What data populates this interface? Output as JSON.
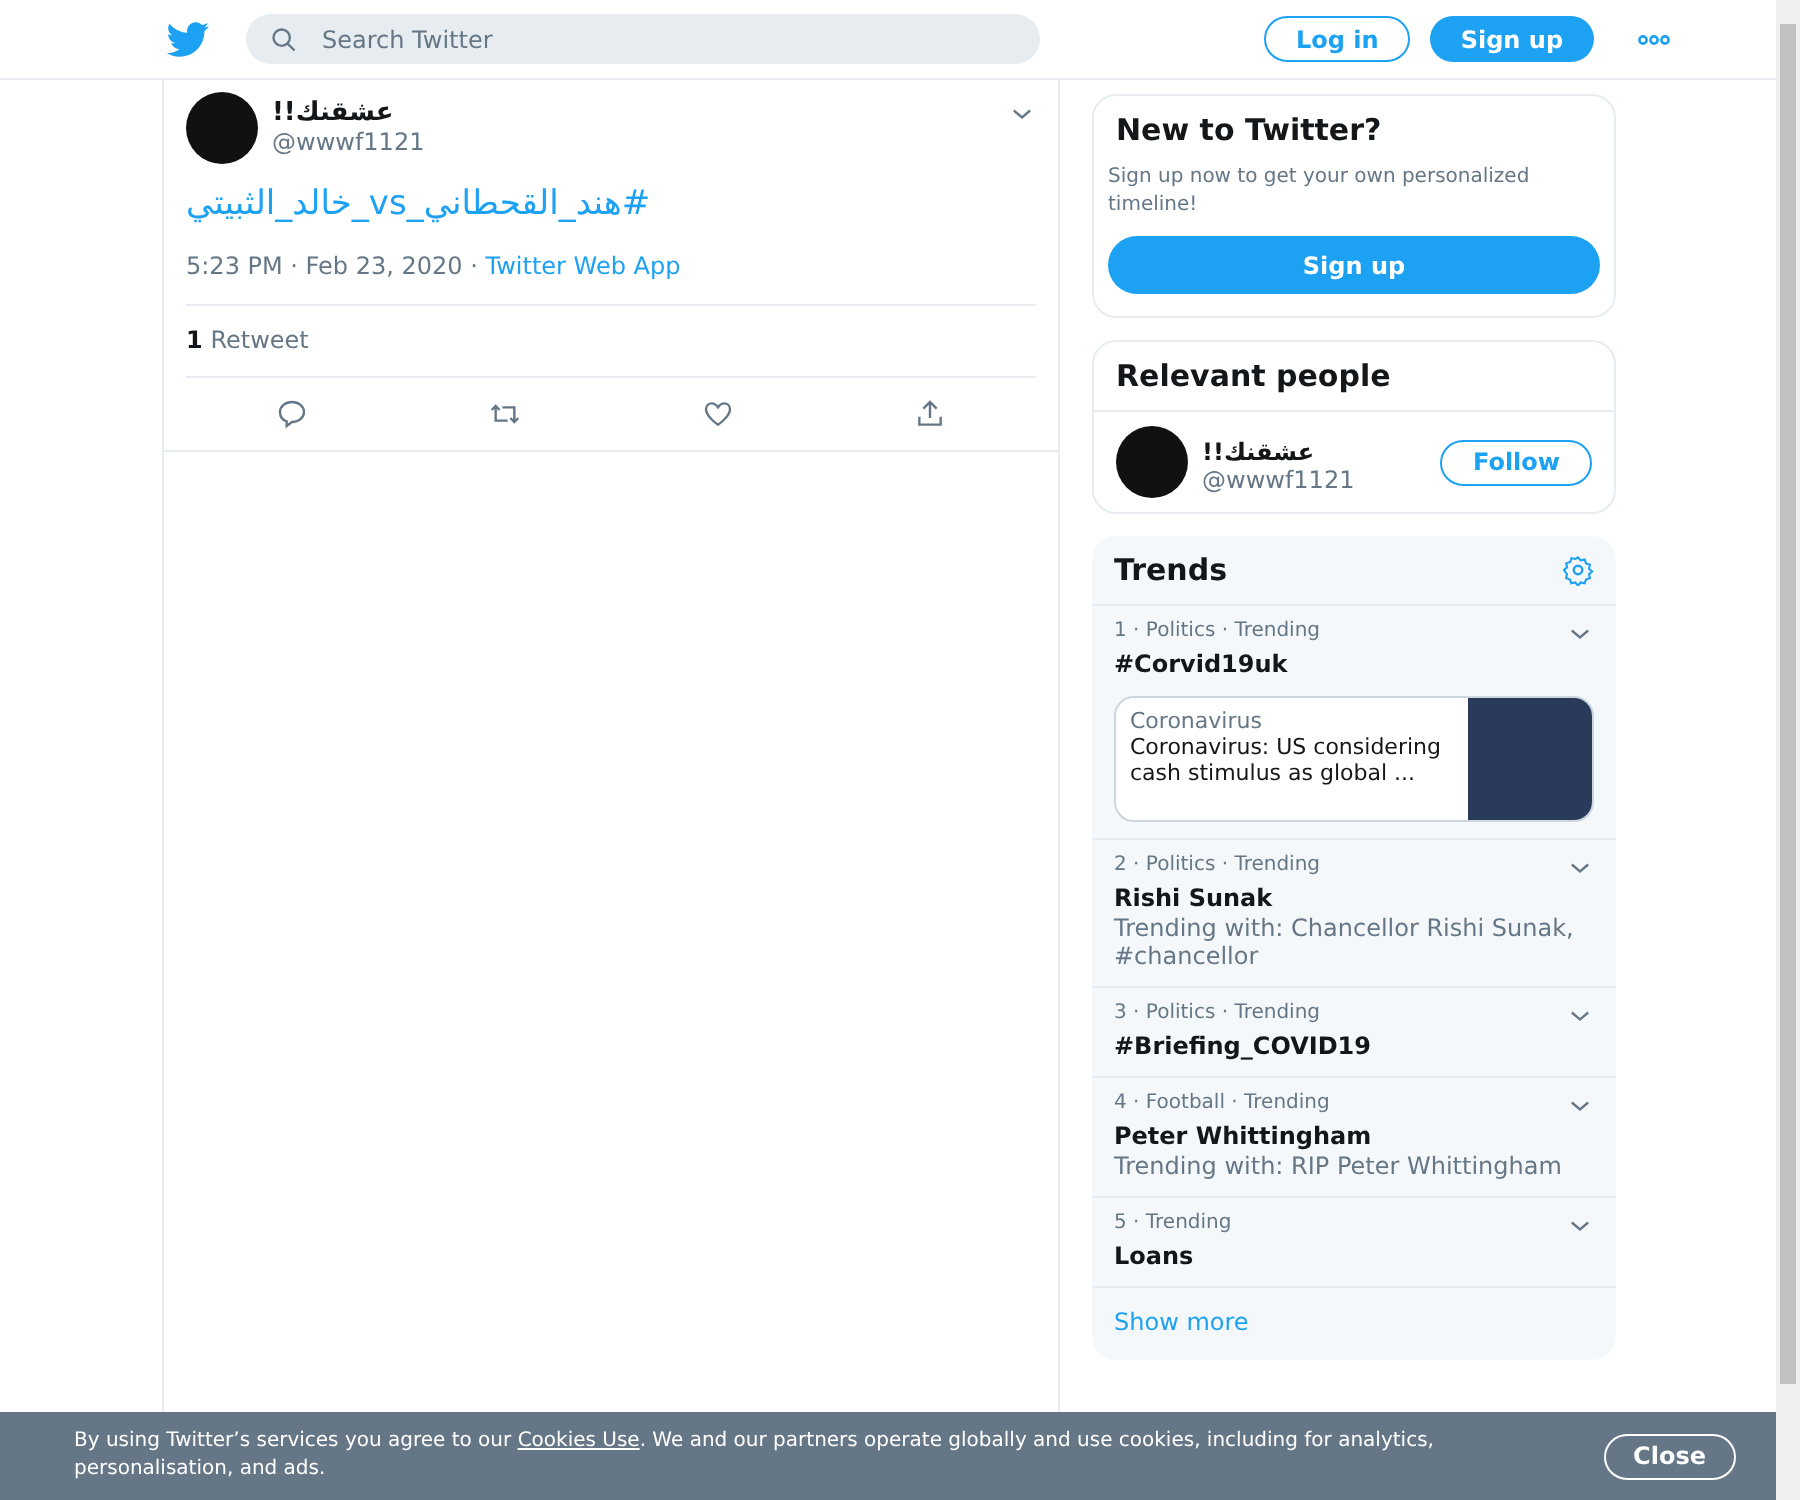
{
  "header": {
    "search": {
      "placeholder": "Search Twitter"
    },
    "login": "Log in",
    "signup": "Sign up"
  },
  "tweet": {
    "name": "!!عشقنك",
    "handle": "@wwwf1121",
    "text": "#هند_القحطاني_vs_خالد_الثبيتي",
    "time": "5:23 PM · Feb 23, 2020 · ",
    "source": "Twitter Web App",
    "retweet_count": "1",
    "retweet_label": "Retweet"
  },
  "new_to_twitter": {
    "title": "New to Twitter?",
    "text": "Sign up now to get your own personalized timeline!",
    "button": "Sign up"
  },
  "relevant_people": {
    "title": "Relevant people",
    "people": [
      {
        "name": "!!عشقنك",
        "handle": "@wwwf1121",
        "button": "Follow"
      }
    ]
  },
  "trends": {
    "title": "Trends",
    "items": [
      {
        "meta": "1 · Politics · Trending",
        "name": "#Corvid19uk",
        "card": {
          "category": "Coronavirus",
          "headline": "Coronavirus: US considering cash stimulus as global ..."
        }
      },
      {
        "meta": "2 · Politics · Trending",
        "name": "Rishi Sunak",
        "context": "Trending with: Chancellor Rishi Sunak, #chancellor"
      },
      {
        "meta": "3 · Politics · Trending",
        "name": "#Briefing_COVID19"
      },
      {
        "meta": "4 · Football · Trending",
        "name": "Peter Whittingham",
        "context": "Trending with: RIP Peter Whittingham"
      },
      {
        "meta": "5 · Trending",
        "name": "Loans"
      }
    ],
    "show_more": "Show more"
  },
  "cookie_bar": {
    "text_before": "By using Twitter’s services you agree to our ",
    "link": "Cookies Use",
    "text_after": ". We and our partners operate globally and use cookies, including for analytics, personalisation, and ads.",
    "button": "Close"
  }
}
